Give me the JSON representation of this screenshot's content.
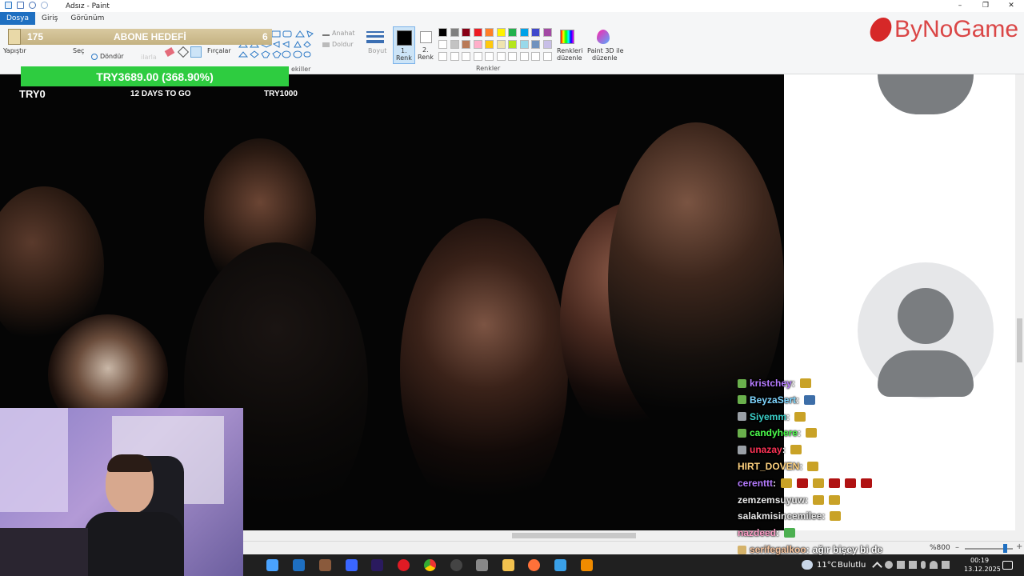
{
  "window": {
    "title": "Adsız - Paint",
    "controls": {
      "minimize": "–",
      "maximize": "❐",
      "close": "✕"
    }
  },
  "menu": {
    "tabs": [
      "Dosya",
      "Giriş",
      "Görünüm"
    ]
  },
  "ribbon": {
    "paste_label": "Yapıştır",
    "select_label": "Seç",
    "rotate_label": "Döndür",
    "brushes_label": "Fırçalar",
    "outline_label": "Anahat",
    "fill_label": "Doldur",
    "size_label": "Boyut",
    "color1_label_line1": "1.",
    "color1_label_line2": "Renk",
    "color2_label_line1": "2.",
    "color2_label_line2": "Renk",
    "edit_colors_line1": "Renkleri",
    "edit_colors_line2": "düzenle",
    "paint3d_line1": "Paint 3D ile",
    "paint3d_line2": "düzenle",
    "colors_group_label": "Renkler",
    "shapes_group_label": "ekiller",
    "faint_tool_text": "ilarla"
  },
  "overlay": {
    "goal_count": "175",
    "goal_title": "ABONE HEDEFİ",
    "goal_target": "6",
    "donation_amount": "TRY3689.00 (368.90%)",
    "donation_start": "TRY0",
    "donation_days": "12 DAYS TO GO",
    "donation_target": "TRY1000",
    "logo_text": "ByNoGame"
  },
  "colors": {
    "palette_row1": [
      "#000000",
      "#7f7f7f",
      "#880015",
      "#ed1c24",
      "#ff7f27",
      "#fff200",
      "#22b14c",
      "#00a2e8",
      "#3f48cc",
      "#a349a4"
    ],
    "palette_row2": [
      "#ffffff",
      "#c3c3c3",
      "#b97a57",
      "#ffaec9",
      "#ffc90e",
      "#efe4b0",
      "#b5e61d",
      "#99d9ea",
      "#7092be",
      "#c8bfe7"
    ],
    "accent": "#1e6fc1",
    "goal_bar": "#2ecc40",
    "logo": "#d62828"
  },
  "chat": [
    {
      "user": "kristchey",
      "color": "#b57bff",
      "suffix": ":",
      "badge_color": "#6ab04c",
      "emotes": [
        "#c9a227"
      ]
    },
    {
      "user": "BeyzaSert",
      "color": "#7fd6ff",
      "suffix": ":",
      "badge_color": "#6ab04c",
      "emotes": [
        "#3d6ea8"
      ]
    },
    {
      "user": "Siyemm",
      "color": "#3ad0c9",
      "suffix": ":",
      "badge_color": "#9aa0a6",
      "emotes": [
        "#c9a227"
      ]
    },
    {
      "user": "candyhere",
      "color": "#4cff4c",
      "suffix": ":",
      "badge_color": "#6ab04c",
      "emotes": [
        "#c9a227"
      ]
    },
    {
      "user": "unazay",
      "color": "#ff3355",
      "suffix": ":",
      "badge_color": "#9aa0a6",
      "emotes": [
        "#c9a227"
      ]
    },
    {
      "user": "HIRT_DOVEN",
      "color": "#ffd27f",
      "suffix": ":",
      "badge_color": "",
      "emotes": [
        "#c9a227"
      ]
    },
    {
      "user": "cerenttt",
      "color": "#b57bff",
      "suffix": ":",
      "badge_color": "",
      "emotes": [
        "#c9a227",
        "#b01212",
        "#c9a227",
        "#b01212",
        "#b01212",
        "#b01212"
      ]
    },
    {
      "user": "zemzemsuyuw",
      "color": "#e6e6e6",
      "suffix": ":",
      "badge_color": "",
      "emotes": [
        "#c9a227",
        "#c9a227"
      ]
    },
    {
      "user": "salakmisincemilee",
      "color": "#e6e6e6",
      "suffix": ":",
      "badge_color": "",
      "emotes": [
        "#c9a227"
      ]
    },
    {
      "user": "nazdeed",
      "color": "#ff9fc8",
      "suffix": ":",
      "badge_color": "",
      "emotes": [
        "#4caf50"
      ]
    },
    {
      "user": "serifegalkoo",
      "color": "#f7c59f",
      "suffix": ":",
      "badge_color": "#d4b26a",
      "message": "ağır bişey bi de",
      "emotes": []
    }
  ],
  "status": {
    "zoom": "%800"
  },
  "taskbar": {
    "weather_temp": "11°C",
    "weather_text": "Bulutlu",
    "time": "00:19",
    "date": "13.12.2025"
  }
}
